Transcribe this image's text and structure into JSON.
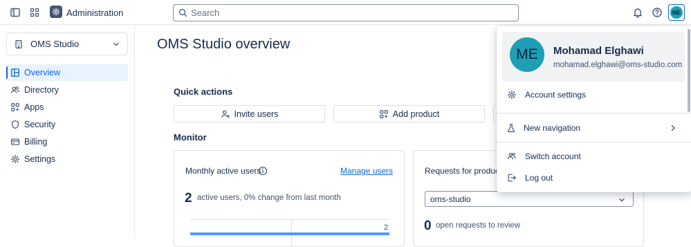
{
  "topbar": {
    "app_title": "Administration",
    "search_placeholder": "Search",
    "avatar_initials": "ME"
  },
  "sidebar": {
    "site_selector": "OMS Studio",
    "items": [
      {
        "label": "Overview",
        "icon": "overview-icon",
        "active": true
      },
      {
        "label": "Directory",
        "icon": "people-icon"
      },
      {
        "label": "Apps",
        "icon": "apps-icon"
      },
      {
        "label": "Security",
        "icon": "shield-icon"
      },
      {
        "label": "Billing",
        "icon": "credit-card-icon"
      },
      {
        "label": "Settings",
        "icon": "gear-icon"
      }
    ]
  },
  "main": {
    "title": "OMS Studio overview",
    "quick_actions_heading": "Quick actions",
    "quick_actions": [
      {
        "label": "Invite users",
        "icon": "add-person-icon"
      },
      {
        "label": "Add product",
        "icon": "add-app-icon"
      }
    ],
    "monitor_heading": "Monitor",
    "mau_card": {
      "title": "Monthly active users",
      "link": "Manage users",
      "count": "2",
      "description": "active users, 0% change from last month",
      "chart_label": "2"
    },
    "requests_card": {
      "title": "Requests for product",
      "select_value": "oms-studio",
      "count": "0",
      "description": "open requests to review"
    }
  },
  "profile_menu": {
    "initials": "ME",
    "name": "Mohamad Elghawi",
    "email": "mohamad.elghawi@oms-studio.com",
    "items": [
      {
        "label": "Account settings",
        "icon": "gear-icon"
      },
      {
        "label": "New navigation",
        "icon": "flask-icon"
      },
      {
        "label": "Switch account",
        "icon": "switch-account-icon"
      },
      {
        "label": "Log out",
        "icon": "logout-icon"
      }
    ]
  },
  "colors": {
    "accent": "#0c66e4",
    "avatar": "#1d9fb5",
    "active_bg": "#e9f2ff"
  }
}
